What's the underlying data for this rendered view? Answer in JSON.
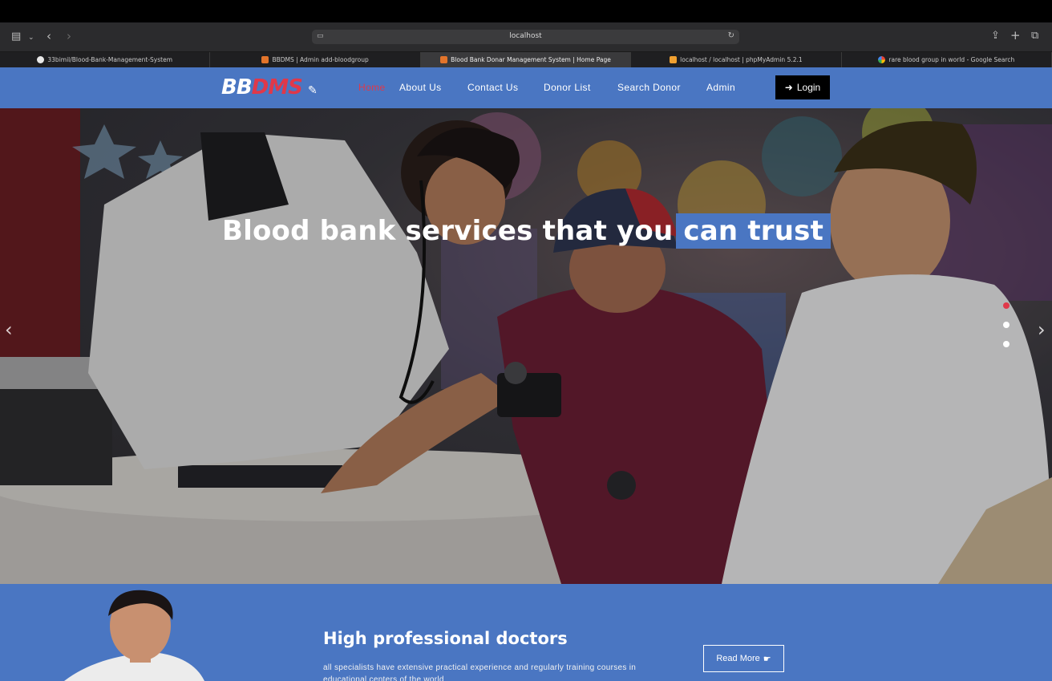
{
  "browser": {
    "address": "localhost",
    "tabs": [
      {
        "label": "33bimil/Blood-Bank-Management-System",
        "icon": "github-icon",
        "active": false
      },
      {
        "label": "BBDMS | Admin add-bloodgroup",
        "icon": "site-icon",
        "active": false
      },
      {
        "label": "Blood Bank Donar Management System | Home Page",
        "icon": "site-icon",
        "active": true
      },
      {
        "label": "localhost / localhost | phpMyAdmin 5.2.1",
        "icon": "phpmyadmin-icon",
        "active": false
      },
      {
        "label": "rare blood group in world - Google Search",
        "icon": "google-icon",
        "active": false
      }
    ]
  },
  "nav": {
    "logo_white": "BB",
    "logo_red": "DMS",
    "links": [
      "Home",
      "About Us",
      "Contact Us",
      "Donor List",
      "Search Donor",
      "Admin"
    ],
    "active_link": "Home",
    "login_label": "Login"
  },
  "hero": {
    "headline_main": "Blood bank services that you",
    "headline_highlight": "can trust",
    "slides": 3,
    "active_slide": 1
  },
  "section": {
    "title": "High professional doctors",
    "text": "all specialists have extensive practical experience and regularly training courses in educational centers of the world",
    "button_label": "Read More"
  },
  "colors": {
    "brand_blue": "#4a76c2",
    "accent_red": "#e0384a",
    "login_bg": "#000000"
  }
}
